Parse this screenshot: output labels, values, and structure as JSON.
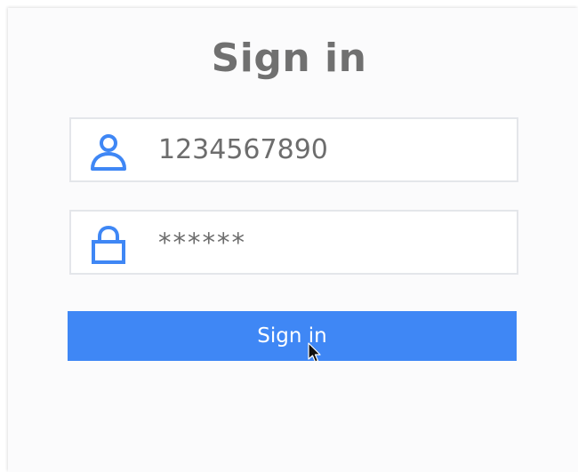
{
  "form": {
    "title": "Sign in",
    "username": {
      "icon": "user-icon",
      "value": "1234567890"
    },
    "password": {
      "icon": "lock-icon",
      "value": "******"
    },
    "submit_label": "Sign in"
  },
  "colors": {
    "accent": "#3f87f5",
    "icon": "#3f87f5",
    "title": "#707070",
    "field_border": "#e4e6ea"
  }
}
